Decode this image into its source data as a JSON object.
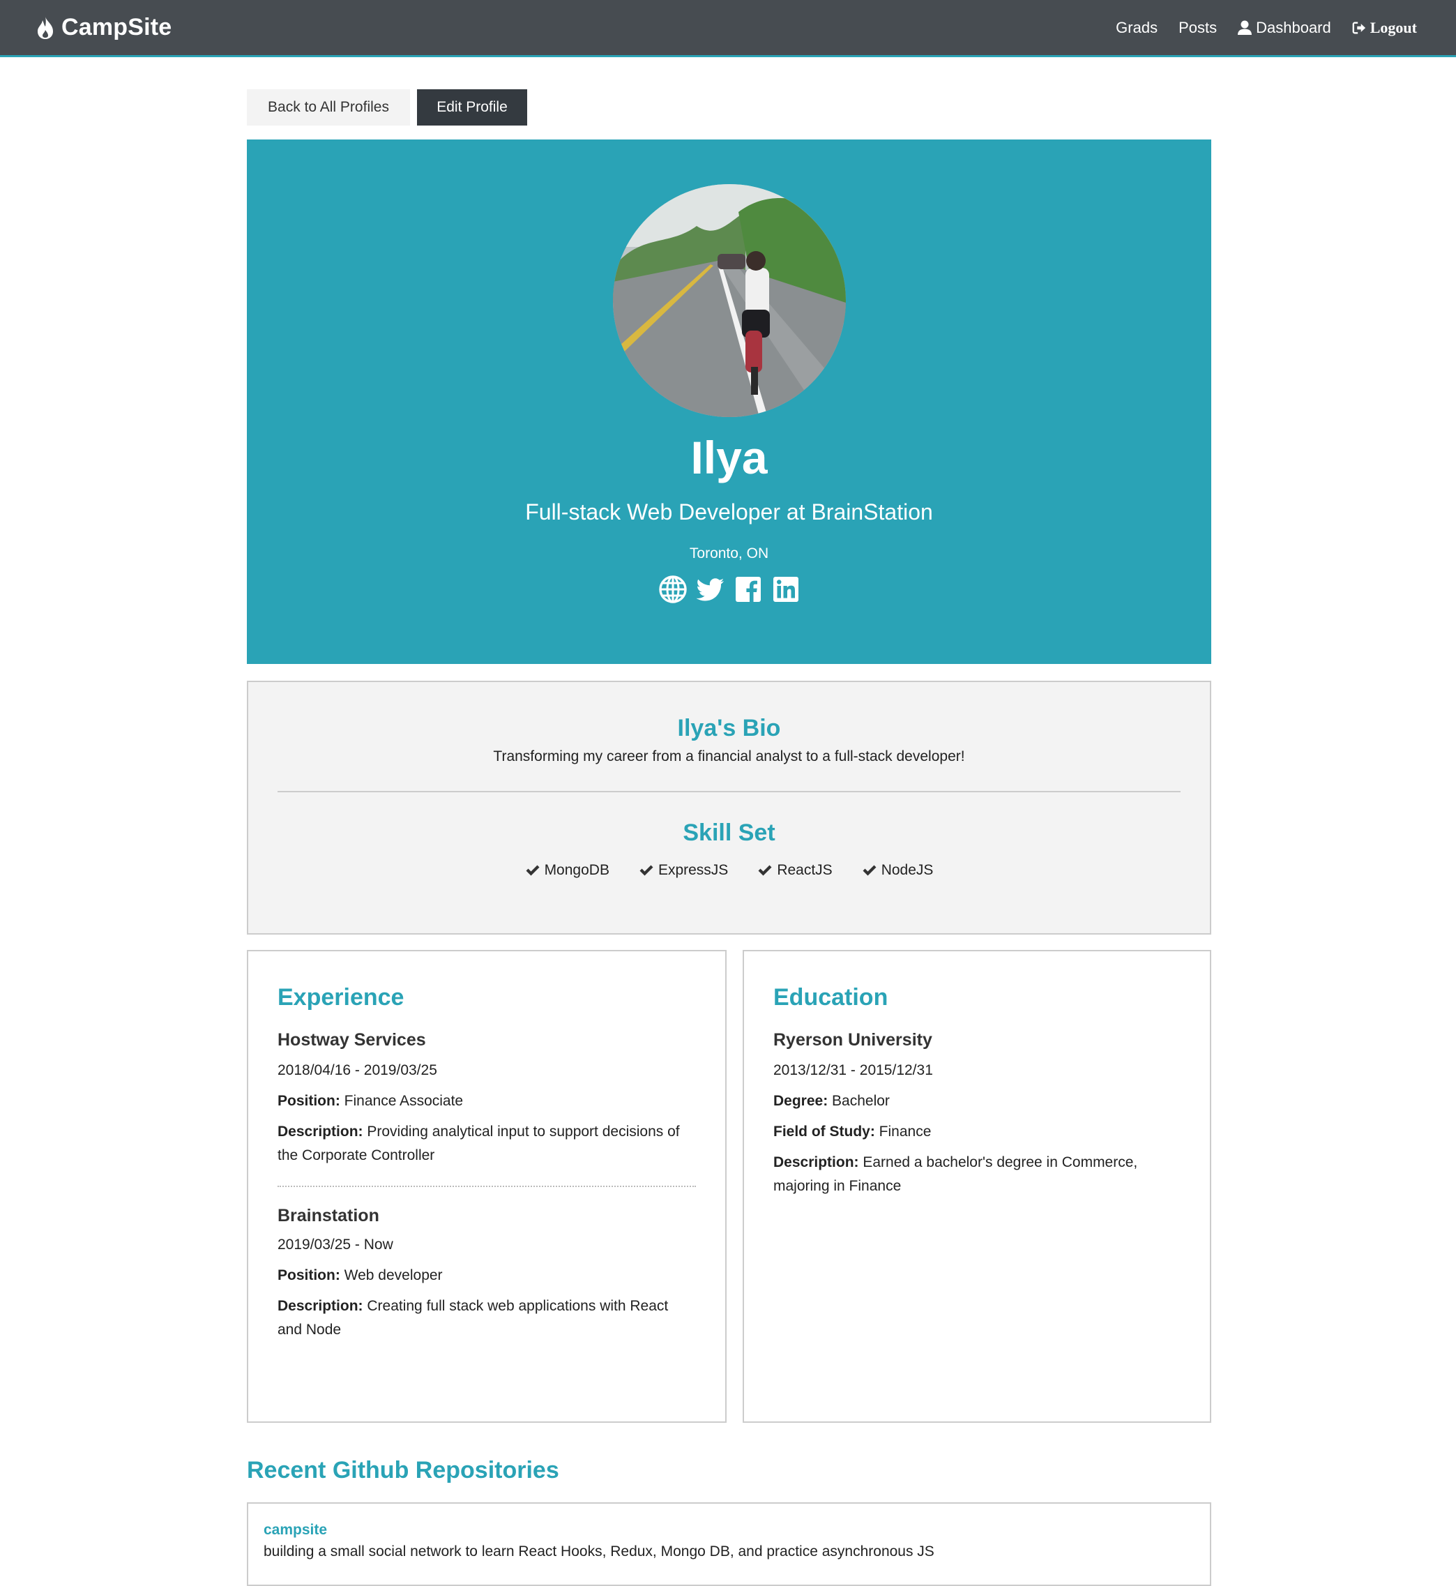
{
  "nav": {
    "brand": "CampSite",
    "links": {
      "grads": "Grads",
      "posts": "Posts",
      "dashboard": "Dashboard",
      "logout": "Logout"
    }
  },
  "actions": {
    "back": "Back to All Profiles",
    "edit": "Edit Profile"
  },
  "profile": {
    "name": "Ilya",
    "status": "Full-stack Web Developer at BrainStation",
    "location": "Toronto, ON",
    "social_icons": [
      "globe-icon",
      "twitter-icon",
      "facebook-icon",
      "linkedin-icon"
    ]
  },
  "about": {
    "bio_title": "Ilya's Bio",
    "bio": "Transforming my career from a financial analyst to a full-stack developer!",
    "skills_title": "Skill Set",
    "skills": [
      "MongoDB",
      "ExpressJS",
      "ReactJS",
      "NodeJS"
    ]
  },
  "experience": {
    "title": "Experience",
    "position_label": "Position:",
    "description_label": "Description:",
    "items": [
      {
        "company": "Hostway Services",
        "dates": "2018/04/16 - 2019/03/25",
        "position": "Finance Associate",
        "description": "Providing analytical input to support decisions of the Corporate Controller"
      },
      {
        "company": "Brainstation",
        "dates": "2019/03/25 - Now",
        "position": "Web developer",
        "description": "Creating full stack web applications with React and Node"
      }
    ]
  },
  "education": {
    "title": "Education",
    "degree_label": "Degree:",
    "field_label": "Field of Study:",
    "description_label": "Description:",
    "items": [
      {
        "school": "Ryerson University",
        "dates": "2013/12/31 - 2015/12/31",
        "degree": "Bachelor",
        "field": "Finance",
        "description": "Earned a bachelor's degree in Commerce, majoring in Finance"
      }
    ]
  },
  "github": {
    "title": "Recent Github Repositories",
    "repos": [
      {
        "name": "campsite",
        "description": "building a small social network to learn React Hooks, Redux, Mongo DB, and practice asynchronous JS"
      }
    ]
  },
  "colors": {
    "navbar": "#474c51",
    "accent": "#2aa3b6",
    "dark_button": "#343a40",
    "light_bg": "#f3f3f3"
  }
}
